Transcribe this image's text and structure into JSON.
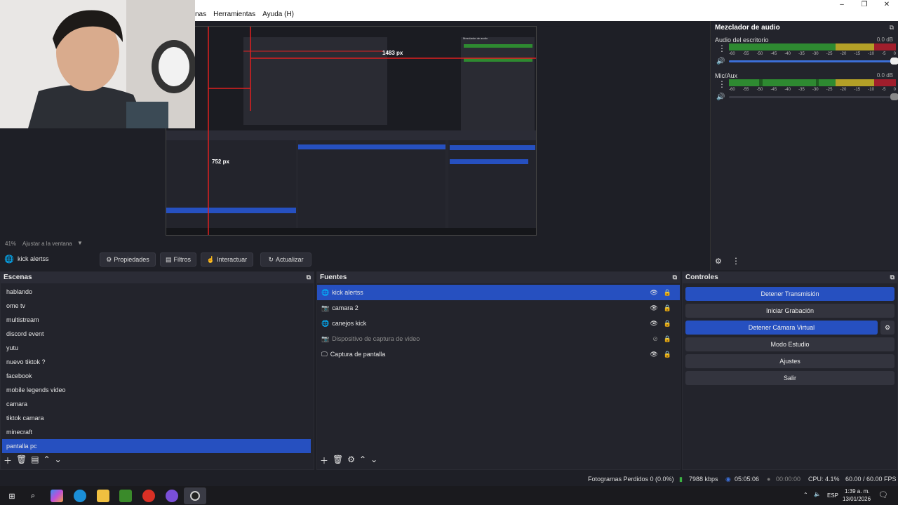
{
  "menu": {
    "items": [
      "nas",
      "Herramientas",
      "Ayuda (H)"
    ]
  },
  "window_controls": [
    "–",
    "❐",
    "✕"
  ],
  "preview": {
    "zoom_label": "41%",
    "fit_label": "Ajustar a la ventana",
    "measure_h": "1483 px",
    "measure_v": "752 px",
    "inner_title": "Mezclador de audio"
  },
  "mixer": {
    "title": "Mezclador de audio",
    "channels": [
      {
        "name": "Audio del escritorio",
        "db": "0.0 dB",
        "volume_pct": 100
      },
      {
        "name": "Mic/Aux",
        "db": "0.0 dB",
        "volume_pct": 100
      }
    ],
    "ticks": [
      "-60",
      "-55",
      "-50",
      "-45",
      "-40",
      "-35",
      "-30",
      "-25",
      "-20",
      "-15",
      "-10",
      "-5",
      "0"
    ]
  },
  "source_toolbar": {
    "source_name": "kick alertss",
    "buttons": [
      "Propiedades",
      "Filtros",
      "Interactuar",
      "Actualizar"
    ]
  },
  "scenes": {
    "title": "Escenas",
    "items": [
      "hablando",
      "ome tv",
      "multistream",
      "discord event",
      "yutu",
      "nuevo tiktok ?",
      "facebook",
      "mobile legends video",
      "camara",
      "tiktok camara",
      "minecraft",
      "pantalla pc"
    ],
    "selected": "pantalla pc"
  },
  "sources": {
    "title": "Fuentes",
    "items": [
      {
        "name": "kick alertss",
        "icon": "globe-icon",
        "visible": true,
        "selected": true
      },
      {
        "name": "camara 2",
        "icon": "camera-icon",
        "visible": true,
        "selected": false
      },
      {
        "name": "canejos  kick",
        "icon": "globe-icon",
        "visible": true,
        "selected": false
      },
      {
        "name": "Dispositivo de captura de video",
        "icon": "camera-icon",
        "visible": false,
        "selected": false
      },
      {
        "name": "Captura de pantalla",
        "icon": "monitor-icon",
        "visible": true,
        "selected": false
      }
    ]
  },
  "controls": {
    "title": "Controles",
    "buttons": [
      {
        "label": "Detener Transmisión",
        "active": true
      },
      {
        "label": "Iniciar Grabación",
        "active": false
      },
      {
        "label": "Detener Cámara Virtual",
        "active": true
      },
      {
        "label": "Modo Estudio",
        "active": false
      },
      {
        "label": "Ajustes",
        "active": false
      },
      {
        "label": "Salir",
        "active": false
      }
    ]
  },
  "status": {
    "dropped": "Fotogramas Perdidos 0 (0.0%)",
    "bitrate": "7988 kbps",
    "stream_time": "05:05:06",
    "rec_time": "00:00:00",
    "cpu": "CPU: 4.1%",
    "fps": "60.00 / 60.00 FPS"
  },
  "taskbar": {
    "lang": "ESP",
    "time": "1:39 a. m.",
    "date": "13/01/2026"
  },
  "colors": {
    "accent": "#2650c0",
    "meter_green": "#2e8a31",
    "meter_yellow": "#b3a027",
    "meter_red": "#a01e2c"
  }
}
